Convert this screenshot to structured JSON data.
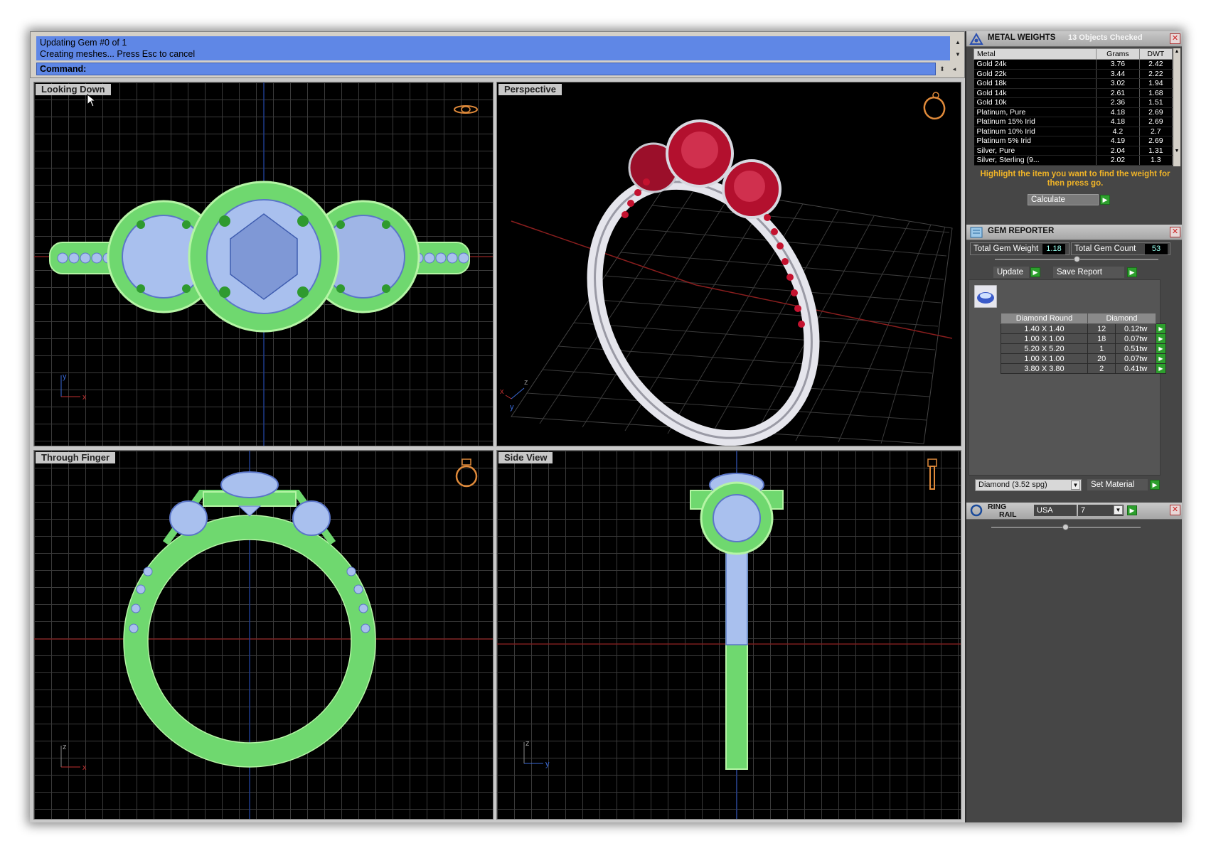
{
  "command": {
    "log_line1": "Updating Gem #0 of 1",
    "log_line2": "Creating meshes... Press Esc to cancel",
    "label": "Command:",
    "value": ""
  },
  "viewports": {
    "top_left": "Looking Down",
    "top_right": "Perspective",
    "bottom_left": "Through Finger",
    "bottom_right": "Side View"
  },
  "axes": {
    "x": "x",
    "y": "y",
    "z": "z"
  },
  "metal_weights": {
    "title": "METAL WEIGHTS",
    "status": "13 Objects Checked",
    "headers": [
      "Metal",
      "Grams",
      "DWT"
    ],
    "rows": [
      [
        "Gold 24k",
        "3.76",
        "2.42"
      ],
      [
        "Gold 22k",
        "3.44",
        "2.22"
      ],
      [
        "Gold 18k",
        "3.02",
        "1.94"
      ],
      [
        "Gold 14k",
        "2.61",
        "1.68"
      ],
      [
        "Gold 10k",
        "2.36",
        "1.51"
      ],
      [
        "Platinum, Pure",
        "4.18",
        "2.69"
      ],
      [
        "Platinum 15% Irid",
        "4.18",
        "2.69"
      ],
      [
        "Platinum 10% Irid",
        "4.2",
        "2.7"
      ],
      [
        "Platinum 5% Irid",
        "4.19",
        "2.69"
      ],
      [
        "Silver, Pure",
        "2.04",
        "1.31"
      ],
      [
        "Silver, Sterling (9...",
        "2.02",
        "1.3"
      ]
    ],
    "hint": "Highlight the item you want to find the weight for then press go.",
    "calculate": "Calculate"
  },
  "gem_reporter": {
    "title": "GEM REPORTER",
    "total_weight_label": "Total Gem Weight",
    "total_weight": "1.18",
    "total_count_label": "Total Gem Count",
    "total_count": "53",
    "update": "Update",
    "save_report": "Save Report",
    "col1": "Diamond Round",
    "col2": "Diamond",
    "rows": [
      [
        "1.40 X 1.40",
        "12",
        "0.12tw"
      ],
      [
        "1.00 X 1.00",
        "18",
        "0.07tw"
      ],
      [
        "5.20 X 5.20",
        "1",
        "0.51tw"
      ],
      [
        "1.00 X 1.00",
        "20",
        "0.07tw"
      ],
      [
        "3.80 X 3.80",
        "2",
        "0.41tw"
      ]
    ],
    "material": "Diamond    (3.52 spg)",
    "set_material": "Set Material"
  },
  "ring_rail": {
    "title_line1": "RING",
    "title_line2": "RAIL",
    "region": "USA",
    "size": "7"
  }
}
